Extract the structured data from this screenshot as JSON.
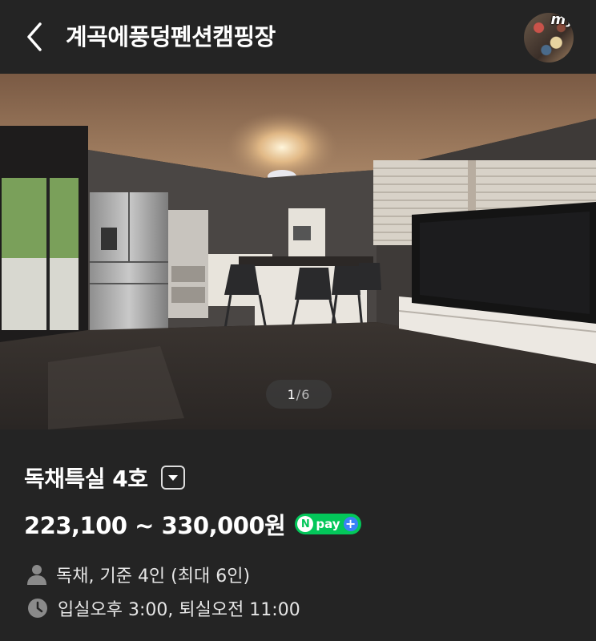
{
  "header": {
    "title": "계곡에풍덩펜션캠핑장",
    "my_label": "my",
    "back_icon": "chevron-left-icon"
  },
  "gallery": {
    "current": "1",
    "separator": "/",
    "total": "6"
  },
  "room": {
    "name": "독채특실 4호",
    "dropdown_icon": "caret-down-icon",
    "price": "223,100 ~ 330,000원",
    "npay": {
      "n": "N",
      "text": "pay",
      "plus": "+"
    }
  },
  "info": {
    "capacity": "독채, 기준 4인 (최대 6인)",
    "capacity_icon": "person-icon",
    "times": "입실오후 3:00, 퇴실오전 11:00",
    "times_icon": "clock-icon"
  },
  "colors": {
    "background": "#242424",
    "npay_green": "#03c75a",
    "npay_plus_blue": "#3b82f6"
  }
}
